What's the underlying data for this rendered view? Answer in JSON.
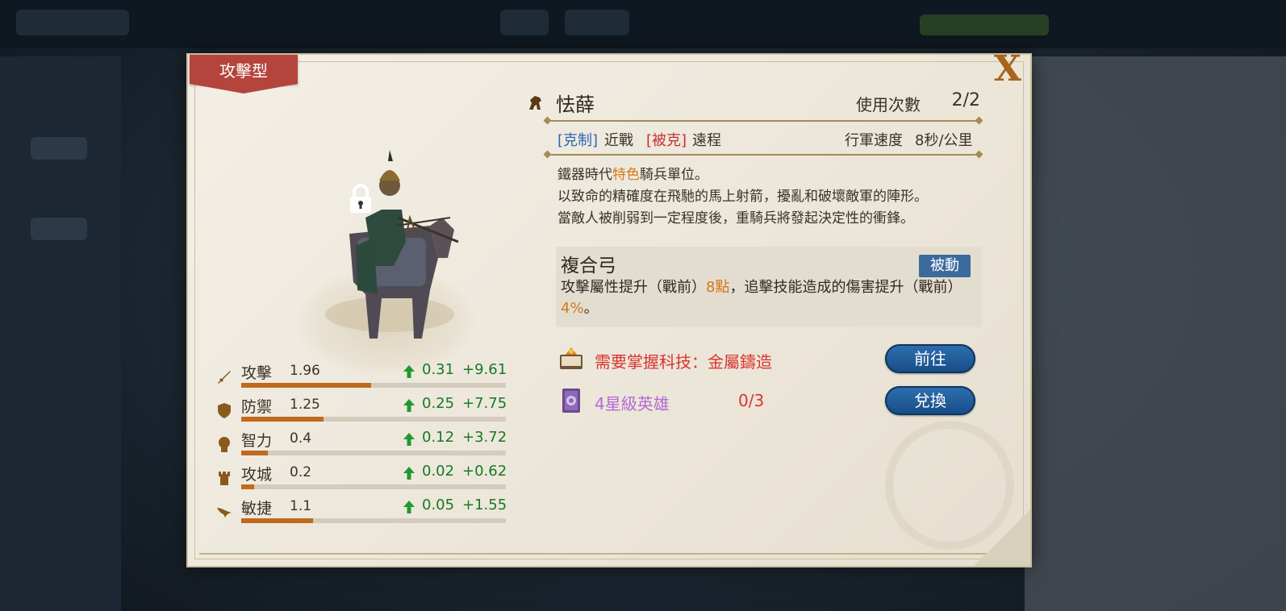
{
  "colors": {
    "ribbon": "#b5443c",
    "close": "#a6641c",
    "stat_bar_fill": "#c06a1d",
    "growth_green": "#157a24",
    "highlight_orange": "#d4791a",
    "counter_blue": "#2e66b5",
    "counter_red": "#c43030",
    "skill_tag_bg": "#3b6a9c",
    "button_blue": "#1f5c9c",
    "req_red": "#d9342f",
    "req_purple": "#b46ad6"
  },
  "panel": {
    "type_label": "攻擊型",
    "close_label": "X",
    "lock_icon": "lock-icon"
  },
  "unit": {
    "name": "怯薛",
    "uses_label": "使用次數",
    "uses_value": "2/2",
    "counter_label": "[克制]",
    "counter_target": "近戰",
    "countered_label": "[被克]",
    "countered_target": "遠程",
    "march_speed_label": "行軍速度",
    "march_speed_value": "8秒/公里",
    "description": {
      "line1_before": "鐵器時代",
      "line1_highlight": "特色",
      "line1_after": "騎兵單位。",
      "line2": "以致命的精確度在飛馳的馬上射箭，擾亂和破壞敵軍的陣形。",
      "line3": "當敵人被削弱到一定程度後，重騎兵將發起決定性的衝鋒。"
    }
  },
  "stats": [
    {
      "icon": "sword-icon",
      "name": "攻擊",
      "base": "1.96",
      "growth": "0.31",
      "bonus": "+9.61",
      "level": 0.49
    },
    {
      "icon": "shield-icon",
      "name": "防禦",
      "base": "1.25",
      "growth": "0.25",
      "bonus": "+7.75",
      "level": 0.31
    },
    {
      "icon": "head-icon",
      "name": "智力",
      "base": "0.4",
      "growth": "0.12",
      "bonus": "+3.72",
      "level": 0.1
    },
    {
      "icon": "tower-icon",
      "name": "攻城",
      "base": "0.2",
      "growth": "0.02",
      "bonus": "+0.62",
      "level": 0.05
    },
    {
      "icon": "wing-icon",
      "name": "敏捷",
      "base": "1.1",
      "growth": "0.05",
      "bonus": "+1.55",
      "level": 0.27
    }
  ],
  "skill": {
    "name": "複合弓",
    "tag": "被動",
    "desc_part1": "攻擊屬性提升（戰前）",
    "desc_val1": "8點",
    "desc_part2": "，追擊技能造成的傷害提升（戰前）",
    "desc_val2": "4%",
    "desc_part3": "。"
  },
  "requirements": [
    {
      "icon": "tech-book-icon",
      "text": "需要掌握科技：金屬鑄造",
      "count": "",
      "button": "前往"
    },
    {
      "icon": "hero-card-icon",
      "text": "4星級英雄",
      "count": "0/3",
      "button": "兌換"
    }
  ]
}
